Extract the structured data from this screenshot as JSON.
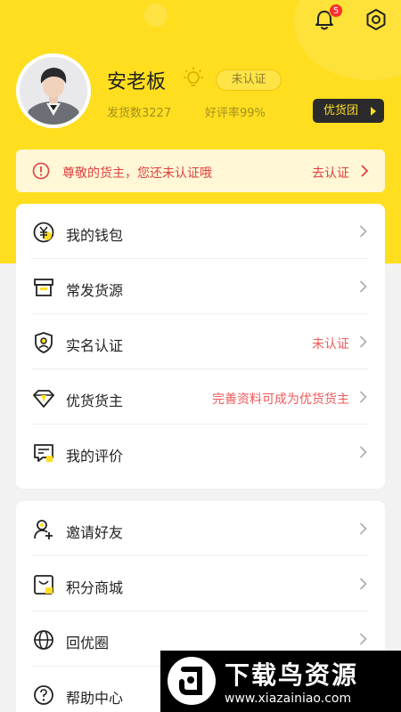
{
  "header": {
    "notification_count": "5",
    "username": "安老板",
    "cert_status": "未认证",
    "shipments_label": "发货数3227",
    "rating_label": "好评率99%",
    "quality_group_label": "优货团"
  },
  "alert": {
    "message": "尊敬的货主，您还未认证哦",
    "action": "去认证"
  },
  "menu_group_1": [
    {
      "label": "我的钱包",
      "icon": "wallet-icon",
      "extra": ""
    },
    {
      "label": "常发货源",
      "icon": "box-icon",
      "extra": ""
    },
    {
      "label": "实名认证",
      "icon": "shield-user-icon",
      "extra": "未认证"
    },
    {
      "label": "优货货主",
      "icon": "diamond-icon",
      "extra": "完善资料可成为优货货主"
    },
    {
      "label": "我的评价",
      "icon": "comment-icon",
      "extra": ""
    }
  ],
  "menu_group_2": [
    {
      "label": "邀请好友",
      "icon": "add-user-icon",
      "extra": ""
    },
    {
      "label": "积分商城",
      "icon": "shopping-bag-icon",
      "extra": ""
    },
    {
      "label": "回优圈",
      "icon": "globe-icon",
      "extra": ""
    },
    {
      "label": "帮助中心",
      "icon": "help-icon",
      "extra": ""
    }
  ],
  "watermark": {
    "title": "下载鸟资源",
    "domain": "www.xiazainiao.com"
  },
  "colors": {
    "brand_yellow": "#fede1f",
    "alert_red": "#e04040",
    "dark_button": "#2b2b2b"
  }
}
